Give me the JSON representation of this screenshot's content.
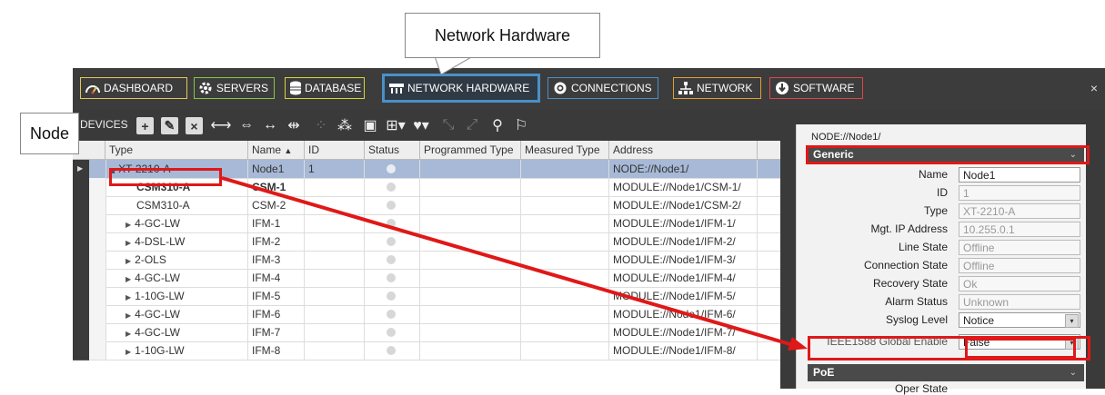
{
  "callouts": {
    "network_hardware": "Network Hardware",
    "node": "Node"
  },
  "tabs": [
    {
      "label": "DASHBOARD",
      "icon": "dashboard-icon"
    },
    {
      "label": "SERVERS",
      "icon": "gear-icon"
    },
    {
      "label": "DATABASE",
      "icon": "database-icon"
    },
    {
      "label": "NETWORK HARDWARE",
      "icon": "network-hardware-icon",
      "active": true
    },
    {
      "label": "CONNECTIONS",
      "icon": "connections-icon"
    },
    {
      "label": "NETWORK",
      "icon": "network-icon"
    },
    {
      "label": "SOFTWARE",
      "icon": "software-icon"
    }
  ],
  "toolbar": {
    "devices_label": "DEVICES"
  },
  "grid": {
    "headers": [
      "Type",
      "Name",
      "ID",
      "Status",
      "Programmed Type",
      "Measured Type",
      "Address"
    ],
    "sort_indicator": "▲",
    "rows": [
      {
        "type": "XT-2210-A",
        "name": "Node1",
        "id": "1",
        "address": "NODE://Node1/",
        "expander": "◢",
        "selected": true
      },
      {
        "type": "CSM310-A",
        "name": "CSM-1",
        "id": "",
        "address": "MODULE://Node1/CSM-1/",
        "expander": "",
        "bold": true
      },
      {
        "type": "CSM310-A",
        "name": "CSM-2",
        "id": "",
        "address": "MODULE://Node1/CSM-2/",
        "expander": ""
      },
      {
        "type": "4-GC-LW",
        "name": "IFM-1",
        "id": "",
        "address": "MODULE://Node1/IFM-1/",
        "expander": "▶"
      },
      {
        "type": "4-DSL-LW",
        "name": "IFM-2",
        "id": "",
        "address": "MODULE://Node1/IFM-2/",
        "expander": "▶"
      },
      {
        "type": "2-OLS",
        "name": "IFM-3",
        "id": "",
        "address": "MODULE://Node1/IFM-3/",
        "expander": "▶"
      },
      {
        "type": "4-GC-LW",
        "name": "IFM-4",
        "id": "",
        "address": "MODULE://Node1/IFM-4/",
        "expander": "▶"
      },
      {
        "type": "1-10G-LW",
        "name": "IFM-5",
        "id": "",
        "address": "MODULE://Node1/IFM-5/",
        "expander": "▶"
      },
      {
        "type": "4-GC-LW",
        "name": "IFM-6",
        "id": "",
        "address": "MODULE://Node1/IFM-6/",
        "expander": "▶"
      },
      {
        "type": "4-GC-LW",
        "name": "IFM-7",
        "id": "",
        "address": "MODULE://Node1/IFM-7/",
        "expander": "▶"
      },
      {
        "type": "1-10G-LW",
        "name": "IFM-8",
        "id": "",
        "address": "MODULE://Node1/IFM-8/",
        "expander": "▶"
      }
    ]
  },
  "panel": {
    "path": "NODE://Node1/",
    "section_generic": "Generic",
    "section_poe": "PoE",
    "properties": [
      {
        "label": "Name",
        "value": "Node1",
        "editable": true
      },
      {
        "label": "ID",
        "value": "1"
      },
      {
        "label": "Type",
        "value": "XT-2210-A"
      },
      {
        "label": "Mgt. IP Address",
        "value": "10.255.0.1"
      },
      {
        "label": "Line State",
        "value": "Offline"
      },
      {
        "label": "Connection State",
        "value": "Offline"
      },
      {
        "label": "Recovery State",
        "value": "Ok"
      },
      {
        "label": "Alarm Status",
        "value": "Unknown"
      },
      {
        "label": "Syslog Level",
        "value": "Notice",
        "editable": true,
        "dropdown": true
      },
      {
        "label": "IEEE1588 Global Enable",
        "value": "False",
        "editable": true,
        "dropdown": true
      }
    ],
    "poe_first_label": "Oper State"
  },
  "colors": {
    "highlight": "#e01818",
    "selected_row": "#a7b9d6",
    "active_tab_border": "#4a90c8"
  }
}
